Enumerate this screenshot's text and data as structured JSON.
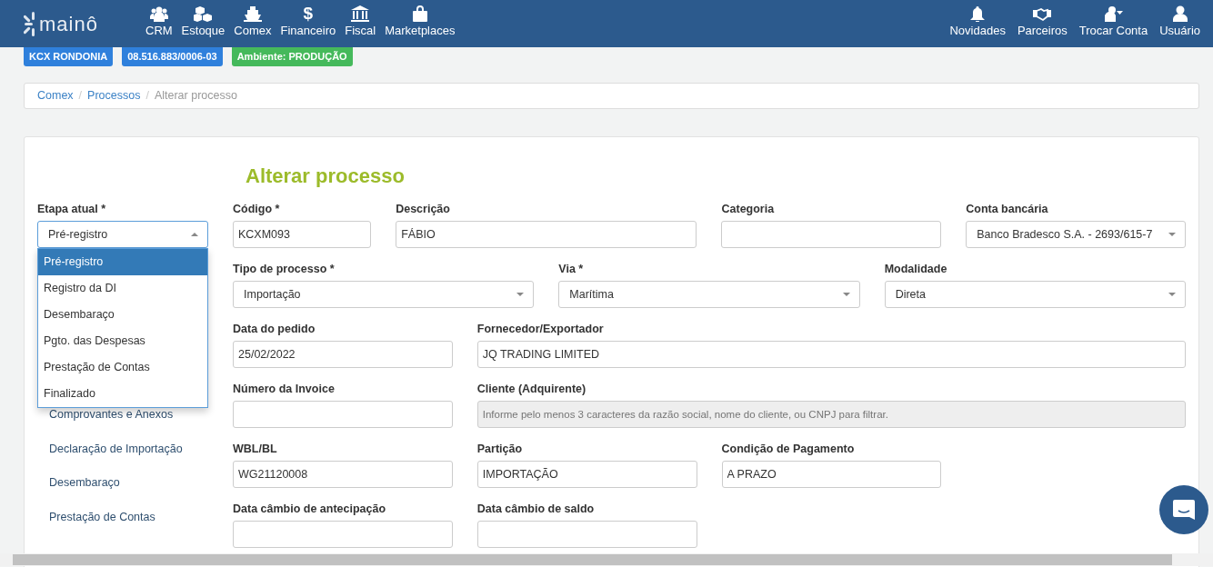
{
  "navbar": {
    "logo": "mainô",
    "menu": [
      {
        "kind": "users",
        "label": "CRM"
      },
      {
        "kind": "cubes",
        "label": "Estoque"
      },
      {
        "kind": "ship",
        "label": "Comex"
      },
      {
        "kind": "dollar",
        "glyph": "$",
        "label": "Financeiro"
      },
      {
        "kind": "bank",
        "label": "Fiscal"
      },
      {
        "kind": "bag",
        "label": "Marketplaces"
      }
    ],
    "right_menu": [
      {
        "kind": "bell",
        "label": "Novidades"
      },
      {
        "kind": "handshake",
        "label": "Parceiros"
      },
      {
        "kind": "user-switch",
        "label": "Trocar Conta"
      },
      {
        "kind": "user",
        "label": "Usuário"
      }
    ]
  },
  "badges": [
    {
      "label": "KCX RONDONIA",
      "color": "#2f80dc"
    },
    {
      "label": "08.516.883/0006-03",
      "color": "#2f80dc"
    },
    {
      "label": "Ambiente: PRODUÇÃO",
      "color": "#45b95b"
    }
  ],
  "breadcrumb": [
    {
      "label": "Comex",
      "current": false
    },
    {
      "separator": "/",
      "label": "Processos",
      "current": false
    },
    {
      "separator": "/",
      "label": "Alterar processo",
      "current": true
    }
  ],
  "title": "Alterar processo",
  "stage": {
    "label": "Etapa atual *",
    "value": "Pré-registro",
    "expanded": true,
    "options": [
      {
        "label": "Pré-registro",
        "selected": true
      },
      {
        "label": "Registro da DI",
        "selected": false
      },
      {
        "label": "Desembaraço",
        "selected": false
      },
      {
        "label": "Pgto. das Despesas",
        "selected": false
      },
      {
        "label": "Prestação de Contas",
        "selected": false
      },
      {
        "label": "Finalizado",
        "selected": false
      }
    ]
  },
  "sidebar_items": [
    "Comprovantes e Anexos",
    "Declaração de Importação",
    "Desembaraço",
    "Prestação de Contas"
  ],
  "form_rows": [
    [
      {
        "kind": "text",
        "label": "Código *",
        "value": "KCXM093"
      },
      {
        "kind": "text",
        "label": "Descrição",
        "value": "FÁBIO"
      },
      {
        "kind": "text",
        "label": "Categoria"
      },
      {
        "kind": "select",
        "label": "Conta bancária",
        "value": "Banco Bradesco S.A. - 2693/615-7"
      }
    ],
    [
      {
        "kind": "select",
        "label": "Tipo de processo *",
        "value": "Importação"
      },
      {
        "kind": "select",
        "label": "Via *",
        "value": "Marítima"
      },
      {
        "kind": "select",
        "label": "Modalidade",
        "value": "Direta"
      }
    ],
    [
      {
        "kind": "text",
        "label": "Data do pedido",
        "value": "25/02/2022"
      },
      {
        "kind": "text",
        "label": "Fornecedor/Exportador",
        "value": "JQ TRADING LIMITED"
      }
    ],
    [
      {
        "kind": "text",
        "label": "Número da Invoice"
      },
      {
        "kind": "text",
        "label": "Cliente (Adquirente)",
        "placeholder": "Informe pelo menos 3 caracteres da razão social, nome do cliente, ou CNPJ para filtrar.",
        "disabled": true
      }
    ],
    [
      {
        "kind": "text",
        "label": "WBL/BL",
        "value": "WG21120008"
      },
      {
        "kind": "text",
        "label": "Partição",
        "value": "IMPORTAÇÃO"
      },
      {
        "kind": "text",
        "label": "Condição de Pagamento",
        "value": "A PRAZO"
      }
    ],
    [
      {
        "kind": "text",
        "label": "Data câmbio de antecipação"
      },
      {
        "kind": "text",
        "label": "Data câmbio de saldo"
      }
    ]
  ]
}
